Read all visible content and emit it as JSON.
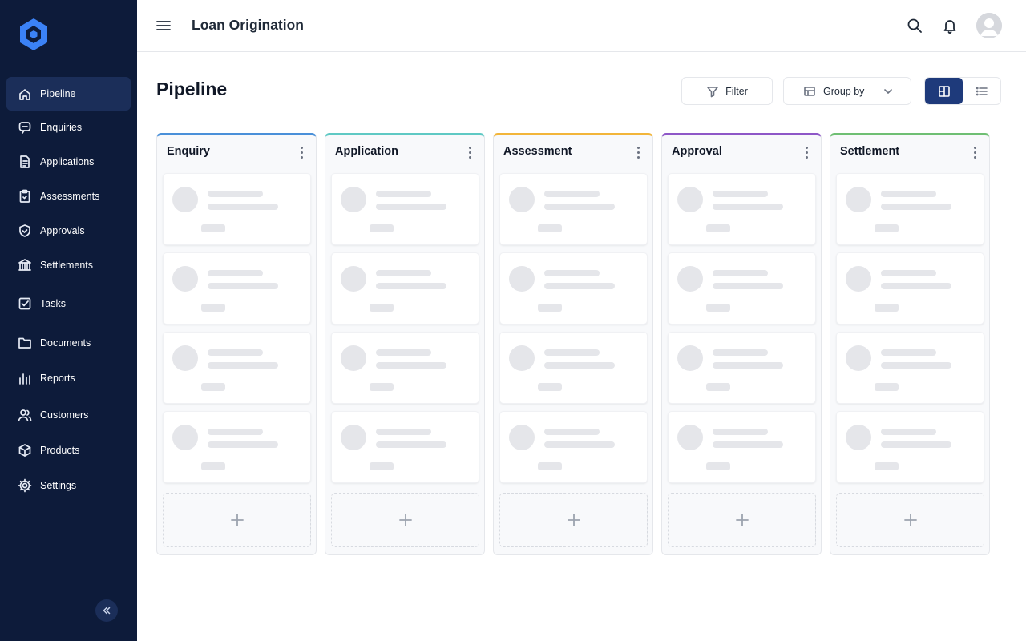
{
  "app": {
    "title": "Loan Origination"
  },
  "sidebar": {
    "items": [
      {
        "label": "Pipeline",
        "icon": "home-icon",
        "active": true
      },
      {
        "label": "Enquiries",
        "icon": "chat-icon"
      },
      {
        "label": "Applications",
        "icon": "document-icon"
      },
      {
        "label": "Assessments",
        "icon": "clipboard-icon"
      },
      {
        "label": "Approvals",
        "icon": "shield-check-icon"
      },
      {
        "label": "Settlements",
        "icon": "bank-icon"
      },
      {
        "label": "Tasks",
        "icon": "checkbox-icon"
      },
      {
        "label": "Documents",
        "icon": "folder-icon"
      },
      {
        "label": "Reports",
        "icon": "bar-chart-icon"
      },
      {
        "label": "Customers",
        "icon": "users-icon"
      },
      {
        "label": "Products",
        "icon": "box-icon"
      },
      {
        "label": "Settings",
        "icon": "gear-icon"
      }
    ]
  },
  "page": {
    "title": "Pipeline"
  },
  "toolbar": {
    "filter_label": "Filter",
    "group_by_label": "Group by",
    "view": "board"
  },
  "columns": [
    {
      "title": "Enquiry",
      "accent": "#4a90d9"
    },
    {
      "title": "Application",
      "accent": "#5fc9c4"
    },
    {
      "title": "Assessment",
      "accent": "#f2b53a"
    },
    {
      "title": "Approval",
      "accent": "#8e57c7"
    },
    {
      "title": "Settlement",
      "accent": "#6fbf73"
    }
  ],
  "colors": {
    "sidebar_bg": "#0d1b3a",
    "sidebar_active": "#1b2e59",
    "primary": "#1e3a7b"
  }
}
